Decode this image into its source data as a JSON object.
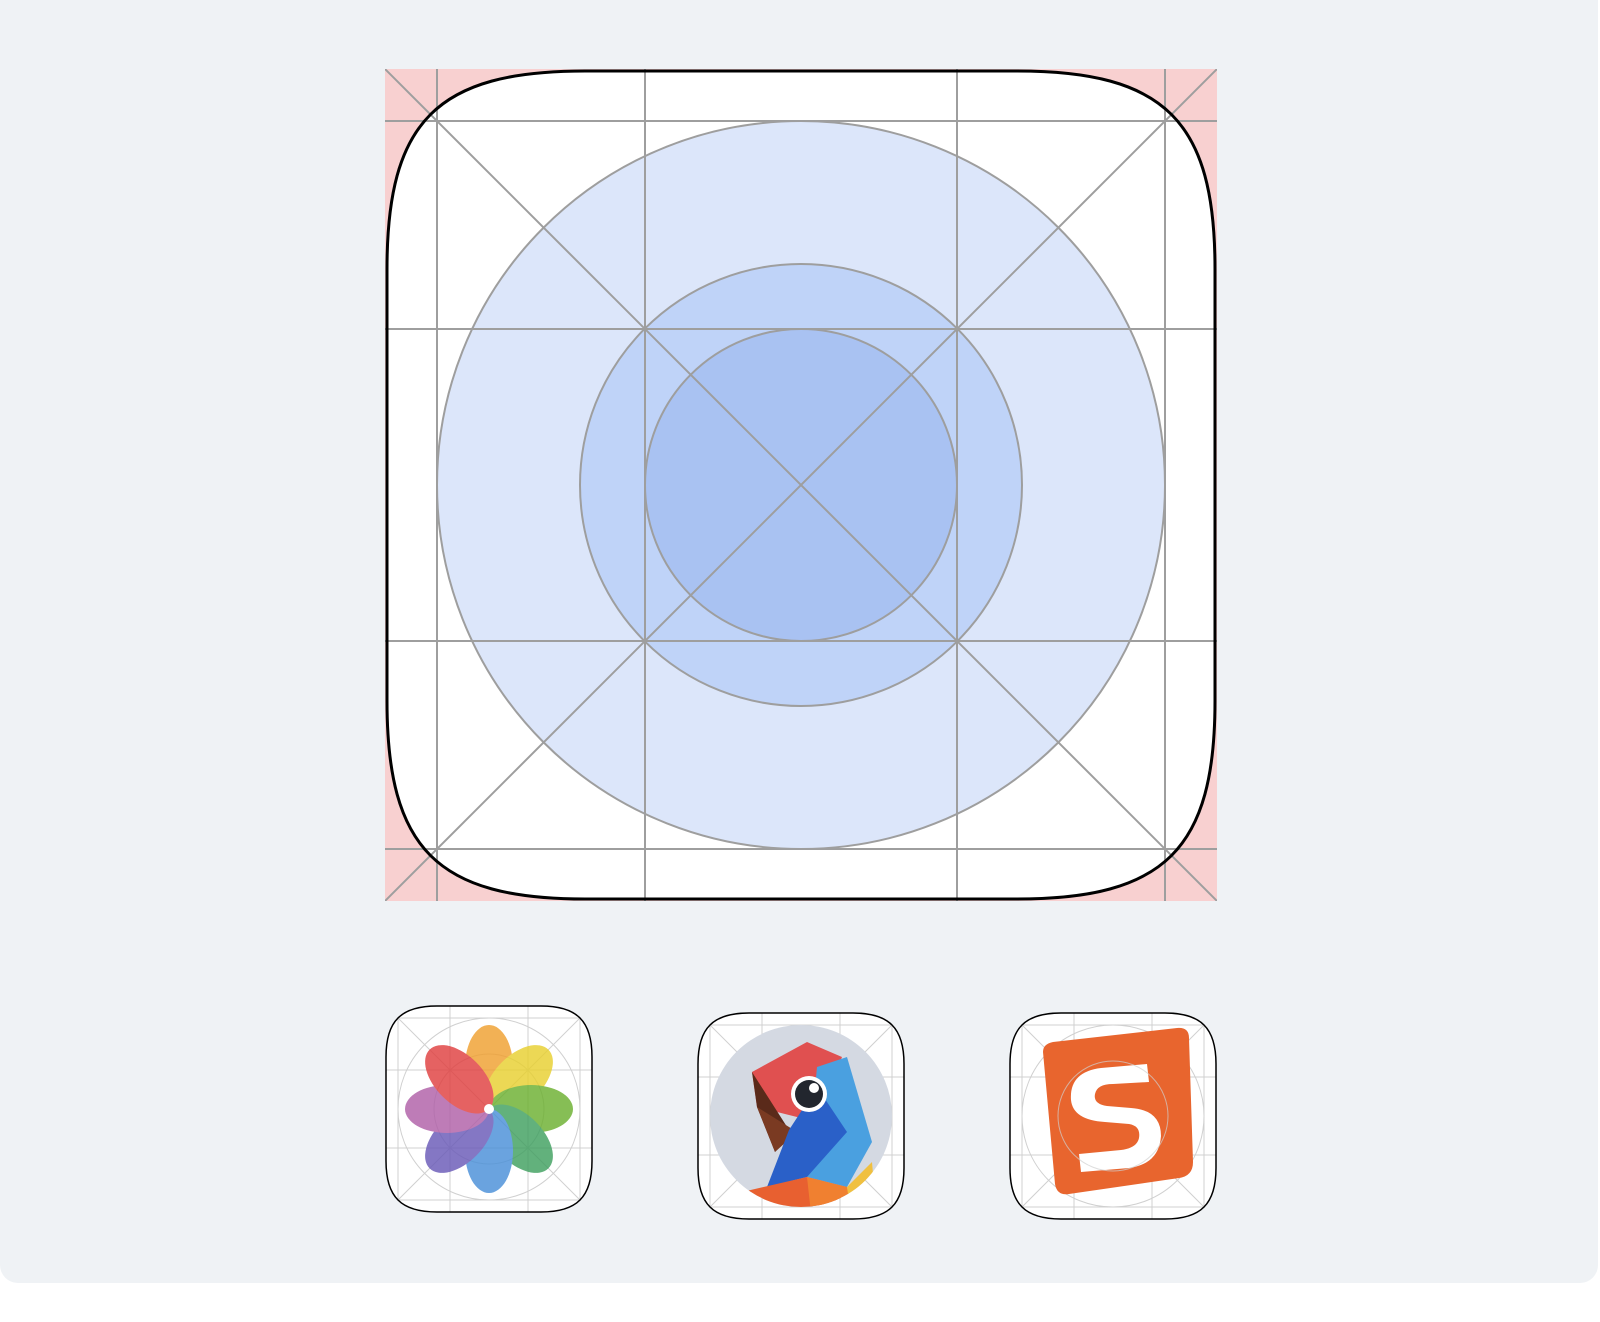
{
  "colors": {
    "background": "#eff2f5",
    "corner_fill": "#f8d0d0",
    "squircle_fill": "#ffffff",
    "outer_circle": "#dce6fa",
    "middle_circle": "#bfd3f8",
    "inner_circle": "#a9c2f2",
    "grid_line": "#9e9e9e",
    "outline": "#000000"
  },
  "icons": [
    {
      "id": "photos",
      "name": "photos-app-icon"
    },
    {
      "id": "parrot",
      "name": "parrot-app-icon"
    },
    {
      "id": "sogou",
      "name": "sogou-app-icon"
    }
  ]
}
